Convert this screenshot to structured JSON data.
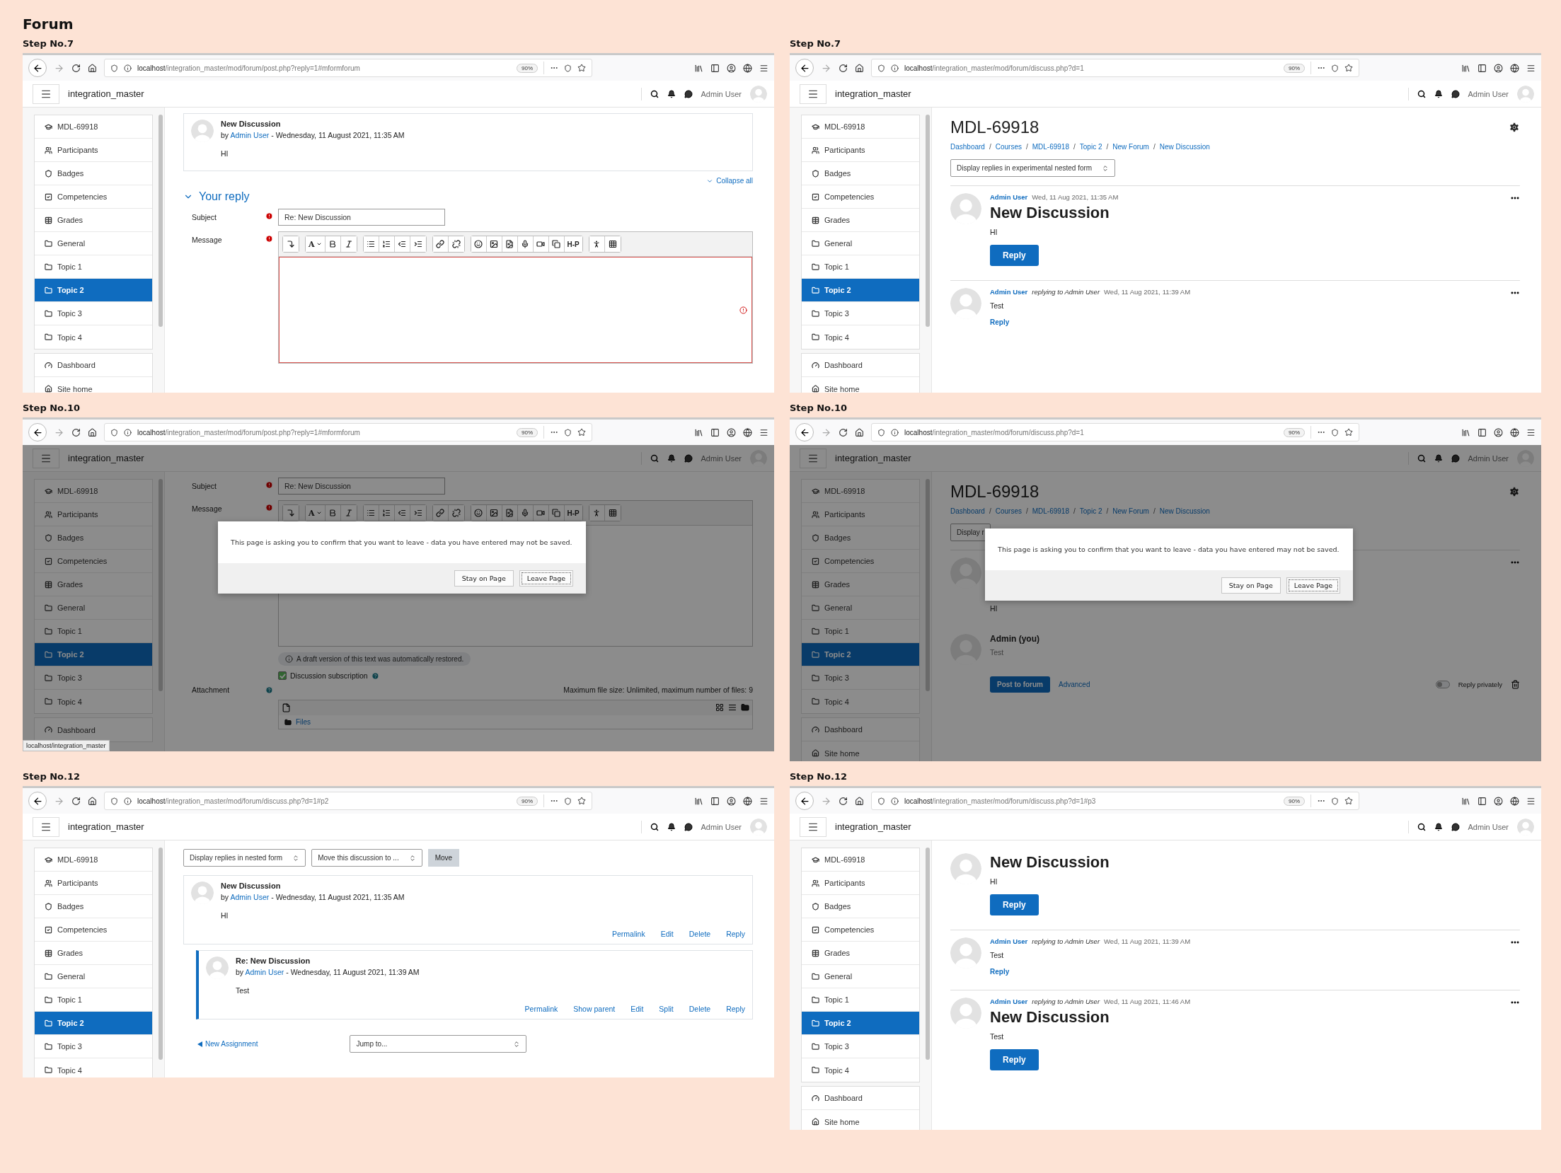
{
  "title": "Forum",
  "panels": [
    {
      "step": "Step No.7",
      "url": {
        "host": "localhost",
        "path": "/integration_master/mod/forum/post.php?reply=1#mformforum",
        "zoom": "90%"
      },
      "site": "integration_master",
      "user": "Admin User",
      "sidebar": [
        {
          "items": [
            {
              "label": "MDL-69918",
              "kind": "course",
              "selected": false
            },
            {
              "label": "Participants",
              "kind": "people",
              "selected": false
            },
            {
              "label": "Badges",
              "kind": "badge",
              "selected": false
            },
            {
              "label": "Competencies",
              "kind": "check",
              "selected": false
            },
            {
              "label": "Grades",
              "kind": "grades",
              "selected": false
            },
            {
              "label": "General",
              "kind": "folder",
              "selected": false
            },
            {
              "label": "Topic 1",
              "kind": "folder",
              "selected": false
            },
            {
              "label": "Topic 2",
              "kind": "folder",
              "selected": true
            },
            {
              "label": "Topic 3",
              "kind": "folder",
              "selected": false
            },
            {
              "label": "Topic 4",
              "kind": "folder",
              "selected": false
            }
          ]
        },
        {
          "items": [
            {
              "label": "Dashboard",
              "kind": "dashboard",
              "selected": false
            },
            {
              "label": "Site home",
              "kind": "home",
              "selected": false
            }
          ]
        }
      ],
      "content": [
        {
          "kind": "post_card",
          "subject": "New Discussion",
          "by": "by",
          "author": "Admin User",
          "meta": "- Wednesday, 11 August 2021, 11:35 AM",
          "body": "HI"
        },
        {
          "kind": "collapse_link",
          "label": "Collapse all"
        },
        {
          "kind": "section_header",
          "label": "Your reply",
          "expanded": true
        },
        {
          "kind": "text_field",
          "label": "Subject",
          "required": true,
          "value": "Re: New Discussion"
        },
        {
          "kind": "editor",
          "label": "Message",
          "required": true,
          "error": true,
          "font_button": "A",
          "h5p_button": "H-P"
        }
      ]
    },
    {
      "step": "Step No.7",
      "url": {
        "host": "localhost",
        "path": "/integration_master/mod/forum/discuss.php?d=1",
        "zoom": "90%"
      },
      "site": "integration_master",
      "user": "Admin User",
      "sidebar": [
        {
          "items": [
            {
              "label": "MDL-69918",
              "kind": "course",
              "selected": false
            },
            {
              "label": "Participants",
              "kind": "people",
              "selected": false
            },
            {
              "label": "Badges",
              "kind": "badge",
              "selected": false
            },
            {
              "label": "Competencies",
              "kind": "check",
              "selected": false
            },
            {
              "label": "Grades",
              "kind": "grades",
              "selected": false
            },
            {
              "label": "General",
              "kind": "folder",
              "selected": false
            },
            {
              "label": "Topic 1",
              "kind": "folder",
              "selected": false
            },
            {
              "label": "Topic 2",
              "kind": "folder",
              "selected": true
            },
            {
              "label": "Topic 3",
              "kind": "folder",
              "selected": false
            },
            {
              "label": "Topic 4",
              "kind": "folder",
              "selected": false
            }
          ]
        },
        {
          "items": [
            {
              "label": "Dashboard",
              "kind": "dashboard",
              "selected": false
            },
            {
              "label": "Site home",
              "kind": "home",
              "selected": false
            }
          ]
        }
      ],
      "content": [
        {
          "kind": "page_heading",
          "title": "MDL-69918"
        },
        {
          "kind": "breadcrumbs",
          "separator": "/",
          "items": [
            "Dashboard",
            "Courses",
            "MDL-69918",
            "Topic 2",
            "New Forum",
            "New Discussion"
          ]
        },
        {
          "kind": "controls",
          "selects": [
            {
              "label": "Display replies in experimental nested form",
              "caret": true
            }
          ]
        },
        {
          "kind": "post",
          "author": "Admin User",
          "date": "Wed, 11 Aug 2021, 11:35 AM",
          "title": "New Discussion",
          "body": "HI",
          "reply": {
            "kind": "button",
            "label": "Reply"
          },
          "menu": true
        },
        {
          "kind": "post",
          "author": "Admin User",
          "relation": "replying to Admin User",
          "date": "Wed, 11 Aug 2021, 11:39 AM",
          "body": "Test",
          "reply": {
            "kind": "link",
            "label": "Reply"
          },
          "menu": true
        }
      ]
    },
    {
      "step": "Step No.10",
      "url": {
        "host": "localhost",
        "path": "/integration_master/mod/forum/post.php?reply=1#mformforum",
        "zoom": "90%"
      },
      "site": "integration_master",
      "user": "Admin User",
      "sidebar": [
        {
          "items": [
            {
              "label": "MDL-69918",
              "kind": "course",
              "selected": false
            },
            {
              "label": "Participants",
              "kind": "people",
              "selected": false
            },
            {
              "label": "Badges",
              "kind": "badge",
              "selected": false
            },
            {
              "label": "Competencies",
              "kind": "check",
              "selected": false
            },
            {
              "label": "Grades",
              "kind": "grades",
              "selected": false
            },
            {
              "label": "General",
              "kind": "folder",
              "selected": false
            },
            {
              "label": "Topic 1",
              "kind": "folder",
              "selected": false
            },
            {
              "label": "Topic 2",
              "kind": "folder",
              "selected": true
            },
            {
              "label": "Topic 3",
              "kind": "folder",
              "selected": false
            },
            {
              "label": "Topic 4",
              "kind": "folder",
              "selected": false
            }
          ]
        },
        {
          "items": [
            {
              "label": "Dashboard",
              "kind": "dashboard",
              "selected": false
            }
          ]
        }
      ],
      "content": [
        {
          "kind": "text_field",
          "label": "Subject",
          "required": true,
          "value": "Re: New Discussion"
        },
        {
          "kind": "editor",
          "label": "Message",
          "required": true,
          "error": false,
          "font_button": "A",
          "h5p_button": "H-P"
        },
        {
          "kind": "draft_notice",
          "text": "A draft version of this text was automatically restored."
        },
        {
          "kind": "checkbox",
          "label": "Discussion subscription",
          "checked": true,
          "help": true
        },
        {
          "kind": "attachment",
          "label": "Attachment",
          "limit": "Maximum file size: Unlimited, maximum number of files: 9",
          "folder": "Files"
        }
      ],
      "dialog": {
        "message": "This page is asking you to confirm that you want to leave - data you have entered may not be saved.",
        "buttons": [
          {
            "label": "Stay on Page",
            "focused": false
          },
          {
            "label": "Leave Page",
            "focused": true
          }
        ]
      },
      "status": "localhost/integration_master"
    },
    {
      "step": "Step No.10",
      "url": {
        "host": "localhost",
        "path": "/integration_master/mod/forum/discuss.php?d=1",
        "zoom": "90%"
      },
      "site": "integration_master",
      "user": "Admin User",
      "sidebar": [
        {
          "items": [
            {
              "label": "MDL-69918",
              "kind": "course",
              "selected": false
            },
            {
              "label": "Participants",
              "kind": "people",
              "selected": false
            },
            {
              "label": "Badges",
              "kind": "badge",
              "selected": false
            },
            {
              "label": "Competencies",
              "kind": "check",
              "selected": false
            },
            {
              "label": "Grades",
              "kind": "grades",
              "selected": false
            },
            {
              "label": "General",
              "kind": "folder",
              "selected": false
            },
            {
              "label": "Topic 1",
              "kind": "folder",
              "selected": false
            },
            {
              "label": "Topic 2",
              "kind": "folder",
              "selected": true
            },
            {
              "label": "Topic 3",
              "kind": "folder",
              "selected": false
            },
            {
              "label": "Topic 4",
              "kind": "folder",
              "selected": false
            }
          ]
        },
        {
          "items": [
            {
              "label": "Dashboard",
              "kind": "dashboard",
              "selected": false
            },
            {
              "label": "Site home",
              "kind": "home",
              "selected": false
            }
          ]
        }
      ],
      "content": [
        {
          "kind": "page_heading",
          "title": "MDL-69918"
        },
        {
          "kind": "breadcrumbs",
          "separator": "/",
          "items": [
            "Dashboard",
            "Courses",
            "MDL-69918",
            "Topic 2",
            "New Forum",
            "New Discussion"
          ]
        },
        {
          "kind": "controls",
          "selects": [
            {
              "label": "Display r",
              "caret": false
            }
          ]
        },
        {
          "kind": "post",
          "body": "HI",
          "menu": true
        },
        {
          "kind": "inline_reply",
          "name": "Admin (you)",
          "body": "Test",
          "submit": "Post to forum",
          "advanced": "Advanced",
          "toggle_label": "Reply privately",
          "private": false
        }
      ],
      "dialog": {
        "message": "This page is asking you to confirm that you want to leave - data you have entered may not be saved.",
        "buttons": [
          {
            "label": "Stay on Page",
            "focused": false
          },
          {
            "label": "Leave Page",
            "focused": true
          }
        ]
      }
    },
    {
      "step": "Step No.12",
      "url": {
        "host": "localhost",
        "path": "/integration_master/mod/forum/discuss.php?d=1#p2",
        "zoom": "90%"
      },
      "site": "integration_master",
      "user": "Admin User",
      "sidebar": [
        {
          "items": [
            {
              "label": "MDL-69918",
              "kind": "course",
              "selected": false
            },
            {
              "label": "Participants",
              "kind": "people",
              "selected": false
            },
            {
              "label": "Badges",
              "kind": "badge",
              "selected": false
            },
            {
              "label": "Competencies",
              "kind": "check",
              "selected": false
            },
            {
              "label": "Grades",
              "kind": "grades",
              "selected": false
            },
            {
              "label": "General",
              "kind": "folder",
              "selected": false
            },
            {
              "label": "Topic 1",
              "kind": "folder",
              "selected": false
            },
            {
              "label": "Topic 2",
              "kind": "folder",
              "selected": true
            },
            {
              "label": "Topic 3",
              "kind": "folder",
              "selected": false
            },
            {
              "label": "Topic 4",
              "kind": "folder",
              "selected": false
            }
          ]
        }
      ],
      "content": [
        {
          "kind": "controls",
          "selects": [
            {
              "label": "Display replies in nested form",
              "caret": true
            },
            {
              "label": "Move this discussion to ...",
              "caret": true
            }
          ],
          "button": "Move"
        },
        {
          "kind": "post_card",
          "nested": false,
          "subject": "New Discussion",
          "by": "by",
          "author": "Admin User",
          "meta": "- Wednesday, 11 August 2021, 11:35 AM",
          "body": "HI",
          "actions": [
            "Permalink",
            "Edit",
            "Delete",
            "Reply"
          ]
        },
        {
          "kind": "post_card",
          "nested": true,
          "subject": "Re: New Discussion",
          "by": "by",
          "author": "Admin User",
          "meta": "- Wednesday, 11 August 2021, 11:39 AM",
          "body": "Test",
          "actions": [
            "Permalink",
            "Show parent",
            "Edit",
            "Split",
            "Delete",
            "Reply"
          ]
        },
        {
          "kind": "footer_nav",
          "prev": "New Assignment",
          "jump": "Jump to..."
        }
      ]
    },
    {
      "step": "Step No.12",
      "url": {
        "host": "localhost",
        "path": "/integration_master/mod/forum/discuss.php?d=1#p3",
        "zoom": "90%"
      },
      "site": "integration_master",
      "user": "Admin User",
      "sidebar": [
        {
          "items": [
            {
              "label": "MDL-69918",
              "kind": "course",
              "selected": false
            },
            {
              "label": "Participants",
              "kind": "people",
              "selected": false
            },
            {
              "label": "Badges",
              "kind": "badge",
              "selected": false
            },
            {
              "label": "Competencies",
              "kind": "check",
              "selected": false
            },
            {
              "label": "Grades",
              "kind": "grades",
              "selected": false
            },
            {
              "label": "General",
              "kind": "folder",
              "selected": false
            },
            {
              "label": "Topic 1",
              "kind": "folder",
              "selected": false
            },
            {
              "label": "Topic 2",
              "kind": "folder",
              "selected": true
            },
            {
              "label": "Topic 3",
              "kind": "folder",
              "selected": false
            },
            {
              "label": "Topic 4",
              "kind": "folder",
              "selected": false
            }
          ]
        },
        {
          "items": [
            {
              "label": "Dashboard",
              "kind": "dashboard",
              "selected": false
            },
            {
              "label": "Site home",
              "kind": "home",
              "selected": false
            }
          ]
        }
      ],
      "content": [
        {
          "kind": "post",
          "title": "New Discussion",
          "body": "HI",
          "reply": {
            "kind": "button",
            "label": "Reply"
          }
        },
        {
          "kind": "post",
          "author": "Admin User",
          "relation": "replying to Admin User",
          "date": "Wed, 11 Aug 2021, 11:39 AM",
          "body": "Test",
          "reply": {
            "kind": "link",
            "label": "Reply"
          },
          "menu": true
        },
        {
          "kind": "post",
          "author": "Admin User",
          "relation": "replying to Admin User",
          "date": "Wed, 11 Aug 2021, 11:46 AM",
          "title": "New Discussion",
          "body": "Test",
          "reply": {
            "kind": "button",
            "label": "Reply"
          },
          "menu": true
        }
      ]
    }
  ]
}
